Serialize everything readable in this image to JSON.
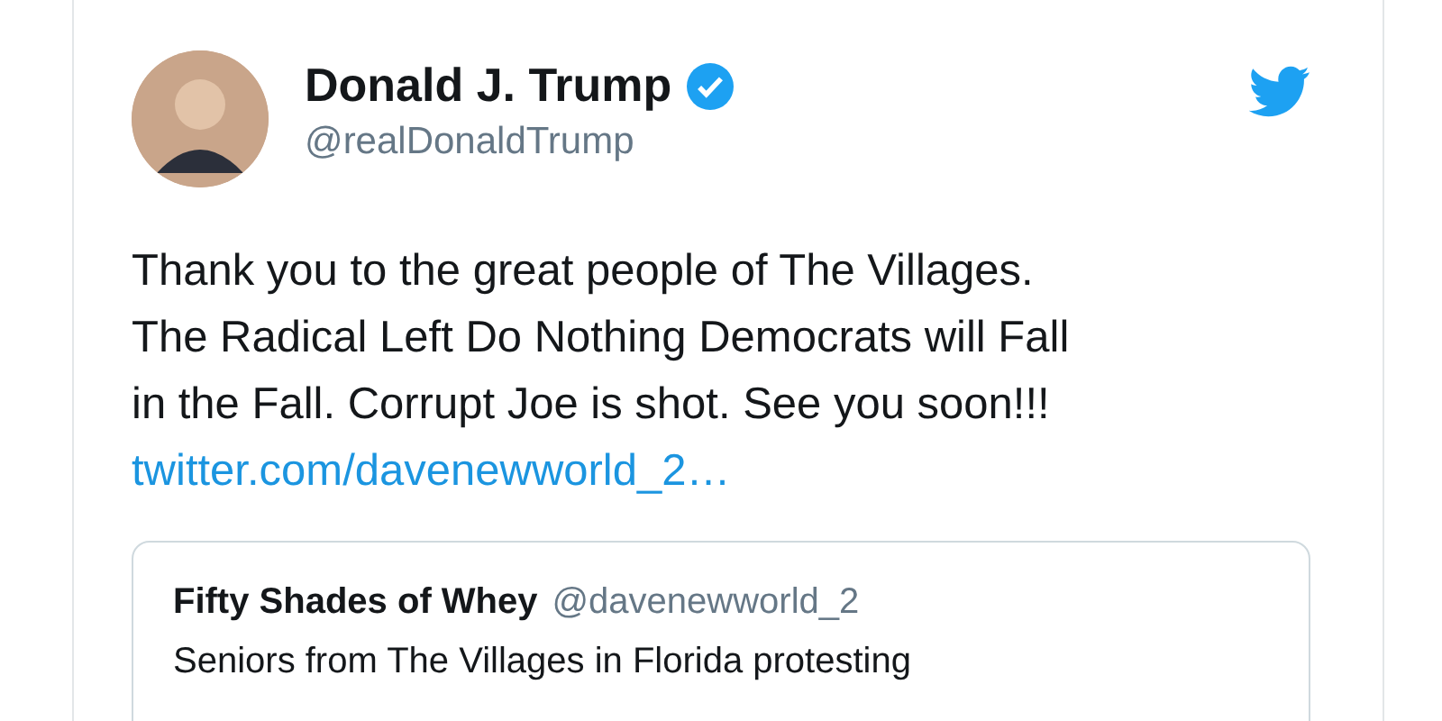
{
  "author": {
    "name": "Donald J. Trump",
    "verified": true,
    "handle": "@realDonaldTrump"
  },
  "tweet": {
    "lines": [
      "Thank you to the great people of The Villages.",
      "The Radical Left Do Nothing Democrats will Fall",
      "in the Fall. Corrupt Joe is shot. See you soon!!!"
    ],
    "link": "twitter.com/davenewworld_2…"
  },
  "quoted": {
    "name": "Fifty Shades of Whey",
    "handle": "@davenewworld_2",
    "text": "Seniors from The Villages in Florida protesting"
  }
}
